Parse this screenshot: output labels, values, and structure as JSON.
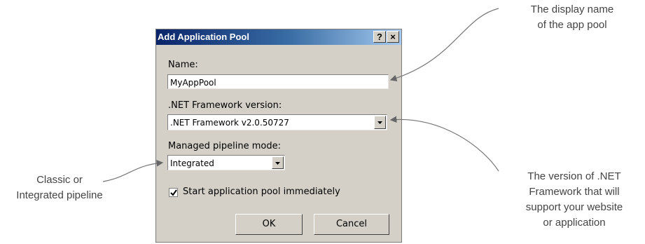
{
  "dialog": {
    "title": "Add Application Pool",
    "help_btn": "?",
    "close_btn": "×",
    "name_label": "Name:",
    "name_value": "MyAppPool",
    "net_label": ".NET Framework version:",
    "net_value": ".NET Framework v2.0.50727",
    "pipeline_label": "Managed pipeline mode:",
    "pipeline_value": "Integrated",
    "start_label": "Start application pool immediately",
    "start_checked": true,
    "ok_label": "OK",
    "cancel_label": "Cancel"
  },
  "callouts": {
    "top_line1": "The display name",
    "top_line2": "of the app pool",
    "left_line1": "Classic or",
    "left_line2": "Integrated pipeline",
    "right_line1": "The version of .NET",
    "right_line2": "Framework that will",
    "right_line3": "support your website",
    "right_line4": "or application"
  }
}
